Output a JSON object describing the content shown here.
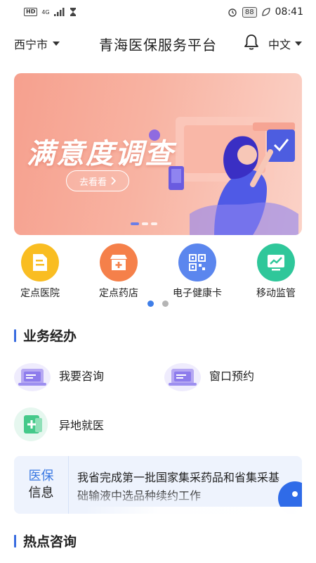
{
  "statusbar": {
    "hd": "HD",
    "net": "4G",
    "battery": "88",
    "time": "08:41"
  },
  "header": {
    "city": "西宁市",
    "title": "青海医保服务平台",
    "language": "中文"
  },
  "banner": {
    "title": "满意度调查",
    "button_label": "去看看",
    "slides": 3,
    "active_slide": 1
  },
  "quick_grid": {
    "items": [
      {
        "label": "定点医院",
        "icon": "hospital-doc-icon",
        "color": "#f9bd22"
      },
      {
        "label": "定点药店",
        "icon": "pharmacy-icon",
        "color": "#f5804a"
      },
      {
        "label": "电子健康卡",
        "icon": "qrcode-icon",
        "color": "#5b86ee"
      },
      {
        "label": "移动监管",
        "icon": "monitor-chart-icon",
        "color": "#2fc79a"
      }
    ],
    "pages": 2,
    "active_page": 1
  },
  "business": {
    "title": "业务经办",
    "items": [
      {
        "label": "我要咨询",
        "icon": "consult-icon"
      },
      {
        "label": "窗口预约",
        "icon": "appointment-icon"
      },
      {
        "label": "异地就医",
        "icon": "remote-medical-icon"
      }
    ]
  },
  "news": {
    "tag_line1": "医保",
    "tag_line2": "信息",
    "text": "我省完成第一批国家集采药品和省集采基础输液中选品种续约工作"
  },
  "hot": {
    "title": "热点咨询"
  },
  "colors": {
    "accent": "#3b6de0",
    "banner": "#f6a08e",
    "news_bg": "#eef3fd"
  }
}
